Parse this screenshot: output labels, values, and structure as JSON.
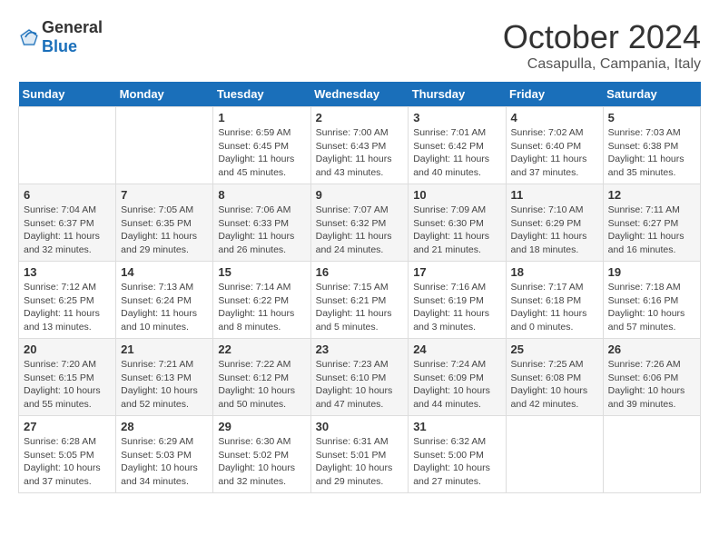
{
  "header": {
    "logo_general": "General",
    "logo_blue": "Blue",
    "month": "October 2024",
    "location": "Casapulla, Campania, Italy"
  },
  "calendar": {
    "weekdays": [
      "Sunday",
      "Monday",
      "Tuesday",
      "Wednesday",
      "Thursday",
      "Friday",
      "Saturday"
    ],
    "weeks": [
      [
        {
          "day": "",
          "info": ""
        },
        {
          "day": "",
          "info": ""
        },
        {
          "day": "1",
          "info": "Sunrise: 6:59 AM\nSunset: 6:45 PM\nDaylight: 11 hours and 45 minutes."
        },
        {
          "day": "2",
          "info": "Sunrise: 7:00 AM\nSunset: 6:43 PM\nDaylight: 11 hours and 43 minutes."
        },
        {
          "day": "3",
          "info": "Sunrise: 7:01 AM\nSunset: 6:42 PM\nDaylight: 11 hours and 40 minutes."
        },
        {
          "day": "4",
          "info": "Sunrise: 7:02 AM\nSunset: 6:40 PM\nDaylight: 11 hours and 37 minutes."
        },
        {
          "day": "5",
          "info": "Sunrise: 7:03 AM\nSunset: 6:38 PM\nDaylight: 11 hours and 35 minutes."
        }
      ],
      [
        {
          "day": "6",
          "info": "Sunrise: 7:04 AM\nSunset: 6:37 PM\nDaylight: 11 hours and 32 minutes."
        },
        {
          "day": "7",
          "info": "Sunrise: 7:05 AM\nSunset: 6:35 PM\nDaylight: 11 hours and 29 minutes."
        },
        {
          "day": "8",
          "info": "Sunrise: 7:06 AM\nSunset: 6:33 PM\nDaylight: 11 hours and 26 minutes."
        },
        {
          "day": "9",
          "info": "Sunrise: 7:07 AM\nSunset: 6:32 PM\nDaylight: 11 hours and 24 minutes."
        },
        {
          "day": "10",
          "info": "Sunrise: 7:09 AM\nSunset: 6:30 PM\nDaylight: 11 hours and 21 minutes."
        },
        {
          "day": "11",
          "info": "Sunrise: 7:10 AM\nSunset: 6:29 PM\nDaylight: 11 hours and 18 minutes."
        },
        {
          "day": "12",
          "info": "Sunrise: 7:11 AM\nSunset: 6:27 PM\nDaylight: 11 hours and 16 minutes."
        }
      ],
      [
        {
          "day": "13",
          "info": "Sunrise: 7:12 AM\nSunset: 6:25 PM\nDaylight: 11 hours and 13 minutes."
        },
        {
          "day": "14",
          "info": "Sunrise: 7:13 AM\nSunset: 6:24 PM\nDaylight: 11 hours and 10 minutes."
        },
        {
          "day": "15",
          "info": "Sunrise: 7:14 AM\nSunset: 6:22 PM\nDaylight: 11 hours and 8 minutes."
        },
        {
          "day": "16",
          "info": "Sunrise: 7:15 AM\nSunset: 6:21 PM\nDaylight: 11 hours and 5 minutes."
        },
        {
          "day": "17",
          "info": "Sunrise: 7:16 AM\nSunset: 6:19 PM\nDaylight: 11 hours and 3 minutes."
        },
        {
          "day": "18",
          "info": "Sunrise: 7:17 AM\nSunset: 6:18 PM\nDaylight: 11 hours and 0 minutes."
        },
        {
          "day": "19",
          "info": "Sunrise: 7:18 AM\nSunset: 6:16 PM\nDaylight: 10 hours and 57 minutes."
        }
      ],
      [
        {
          "day": "20",
          "info": "Sunrise: 7:20 AM\nSunset: 6:15 PM\nDaylight: 10 hours and 55 minutes."
        },
        {
          "day": "21",
          "info": "Sunrise: 7:21 AM\nSunset: 6:13 PM\nDaylight: 10 hours and 52 minutes."
        },
        {
          "day": "22",
          "info": "Sunrise: 7:22 AM\nSunset: 6:12 PM\nDaylight: 10 hours and 50 minutes."
        },
        {
          "day": "23",
          "info": "Sunrise: 7:23 AM\nSunset: 6:10 PM\nDaylight: 10 hours and 47 minutes."
        },
        {
          "day": "24",
          "info": "Sunrise: 7:24 AM\nSunset: 6:09 PM\nDaylight: 10 hours and 44 minutes."
        },
        {
          "day": "25",
          "info": "Sunrise: 7:25 AM\nSunset: 6:08 PM\nDaylight: 10 hours and 42 minutes."
        },
        {
          "day": "26",
          "info": "Sunrise: 7:26 AM\nSunset: 6:06 PM\nDaylight: 10 hours and 39 minutes."
        }
      ],
      [
        {
          "day": "27",
          "info": "Sunrise: 6:28 AM\nSunset: 5:05 PM\nDaylight: 10 hours and 37 minutes."
        },
        {
          "day": "28",
          "info": "Sunrise: 6:29 AM\nSunset: 5:03 PM\nDaylight: 10 hours and 34 minutes."
        },
        {
          "day": "29",
          "info": "Sunrise: 6:30 AM\nSunset: 5:02 PM\nDaylight: 10 hours and 32 minutes."
        },
        {
          "day": "30",
          "info": "Sunrise: 6:31 AM\nSunset: 5:01 PM\nDaylight: 10 hours and 29 minutes."
        },
        {
          "day": "31",
          "info": "Sunrise: 6:32 AM\nSunset: 5:00 PM\nDaylight: 10 hours and 27 minutes."
        },
        {
          "day": "",
          "info": ""
        },
        {
          "day": "",
          "info": ""
        }
      ]
    ]
  }
}
